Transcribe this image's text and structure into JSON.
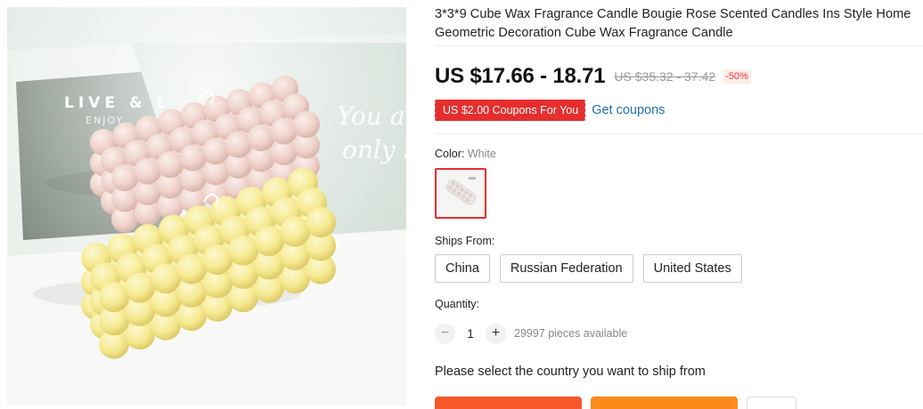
{
  "product": {
    "title": "3*3*9 Cube Wax Fragrance Candle Bougie Rose Scented Candles Ins Style Home Geometric Decoration Cube Wax Fragrance Candle",
    "image_text": {
      "sign_line1": "LIVE & L",
      "sign_line2": "ENJOY",
      "script_line1": "You are",
      "script_line2": "only l"
    }
  },
  "price": {
    "current": "US $17.66 - 18.71",
    "original": "US $35.32 - 37.42",
    "discount": "-50%"
  },
  "coupon": {
    "badge": "US $2.00 Coupons For You",
    "link": "Get coupons"
  },
  "color": {
    "label": "Color:",
    "selected": "White"
  },
  "shipping": {
    "label": "Ships From:",
    "options": [
      "China",
      "Russian Federation",
      "United States"
    ],
    "prompt": "Please select the country you want to ship from"
  },
  "quantity": {
    "label": "Quantity:",
    "minus": "−",
    "value": "1",
    "plus": "+",
    "available": "29997 pieces available"
  },
  "colors": {
    "accent_red": "#e62e2e",
    "link_blue": "#1f6fb2",
    "buy_now": "#f6582a",
    "add_to_cart": "#fb8a1b",
    "candle_pink": "#f0d6d0",
    "candle_yellow": "#f7ec9c"
  },
  "icons": {
    "minus": "minus-icon",
    "plus": "plus-icon"
  }
}
